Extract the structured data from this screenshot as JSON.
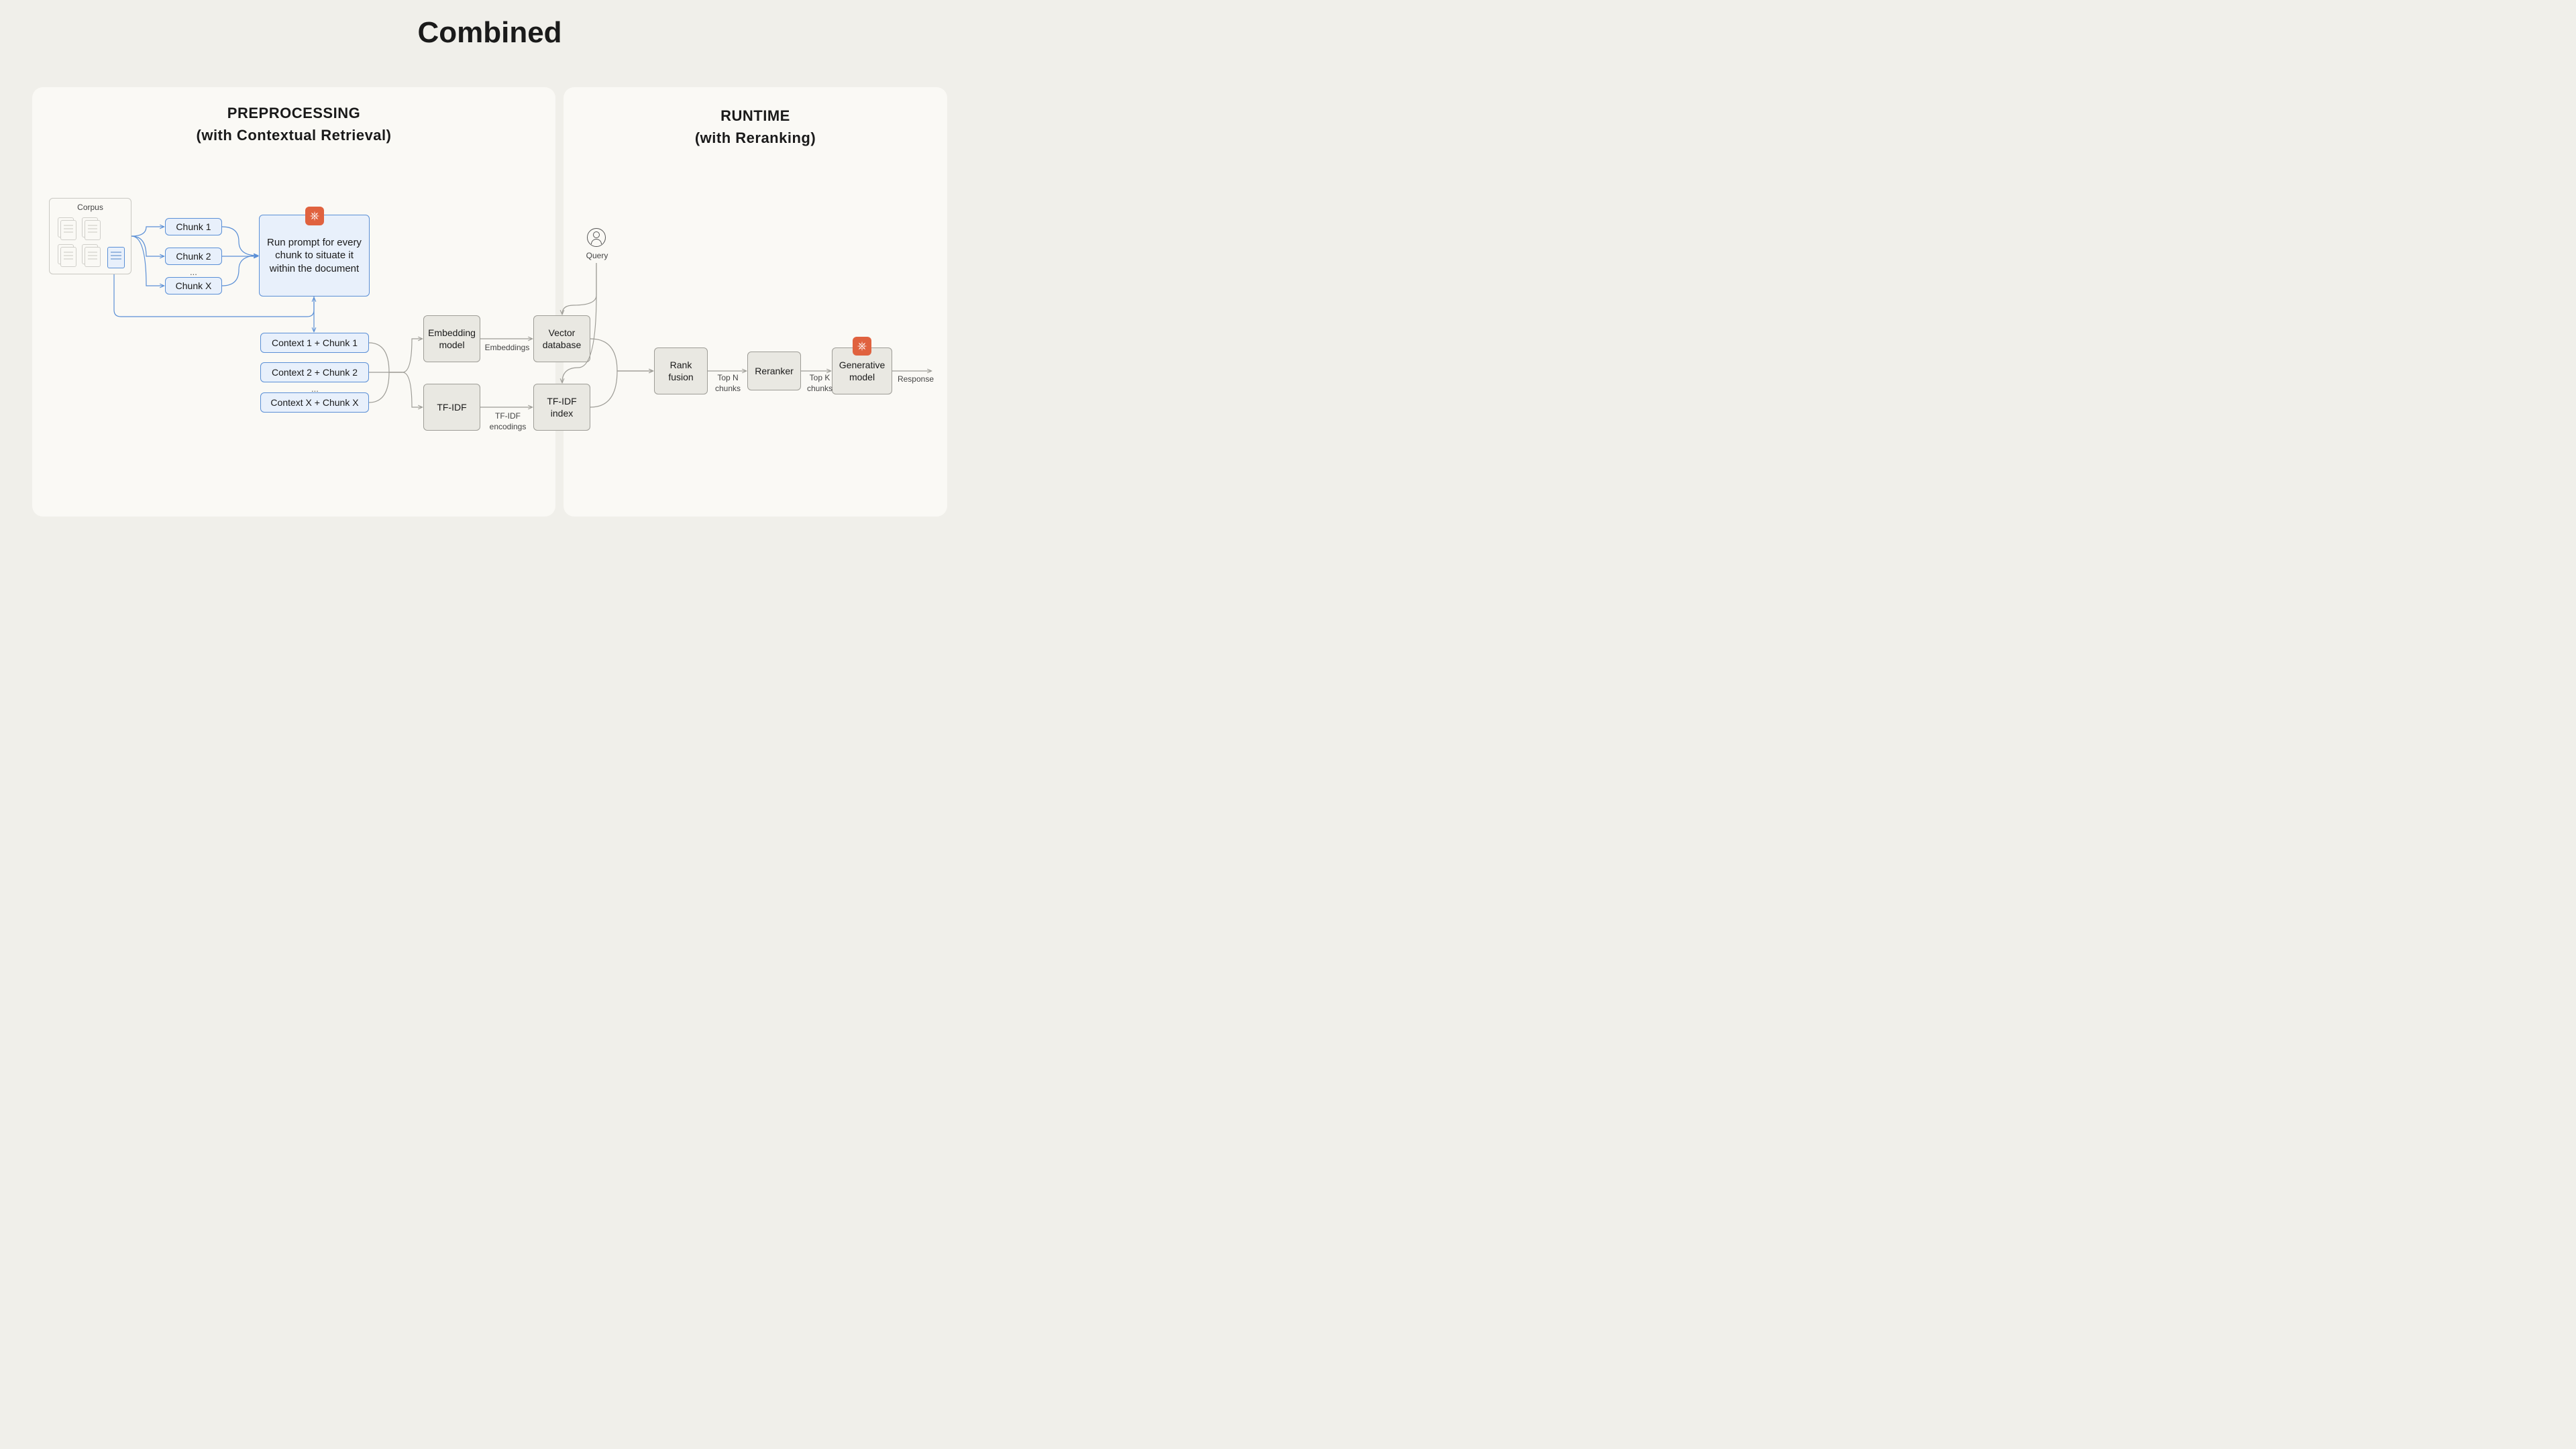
{
  "title": "Combined",
  "panels": {
    "left": {
      "line1": "PREPROCESSING",
      "line2": "(with Contextual Retrieval)"
    },
    "right": {
      "line1": "RUNTIME",
      "line2": "(with Reranking)"
    }
  },
  "corpus": {
    "label": "Corpus"
  },
  "chunks": {
    "c1": "Chunk 1",
    "c2": "Chunk 2",
    "cx": "Chunk X",
    "ell": "..."
  },
  "prompt": "Run prompt for every chunk to situate it within the document",
  "contexts": {
    "c1": "Context 1 + Chunk 1",
    "c2": "Context 2 + Chunk 2",
    "cx": "Context X + Chunk X",
    "ell": "..."
  },
  "boxes": {
    "embedding": "Embedding model",
    "tfidf": "TF-IDF",
    "vectordb": "Vector database",
    "tfidfidx": "TF-IDF index",
    "rankfusion": "Rank fusion",
    "reranker": "Reranker",
    "genmodel": "Generative model"
  },
  "labels": {
    "embeddings": "Embeddings",
    "tfidfenc1": "TF-IDF",
    "tfidfenc2": "encodings",
    "query": "Query",
    "topn1": "Top N",
    "topn2": "chunks",
    "topk1": "Top K",
    "topk2": "chunks",
    "response": "Response"
  }
}
